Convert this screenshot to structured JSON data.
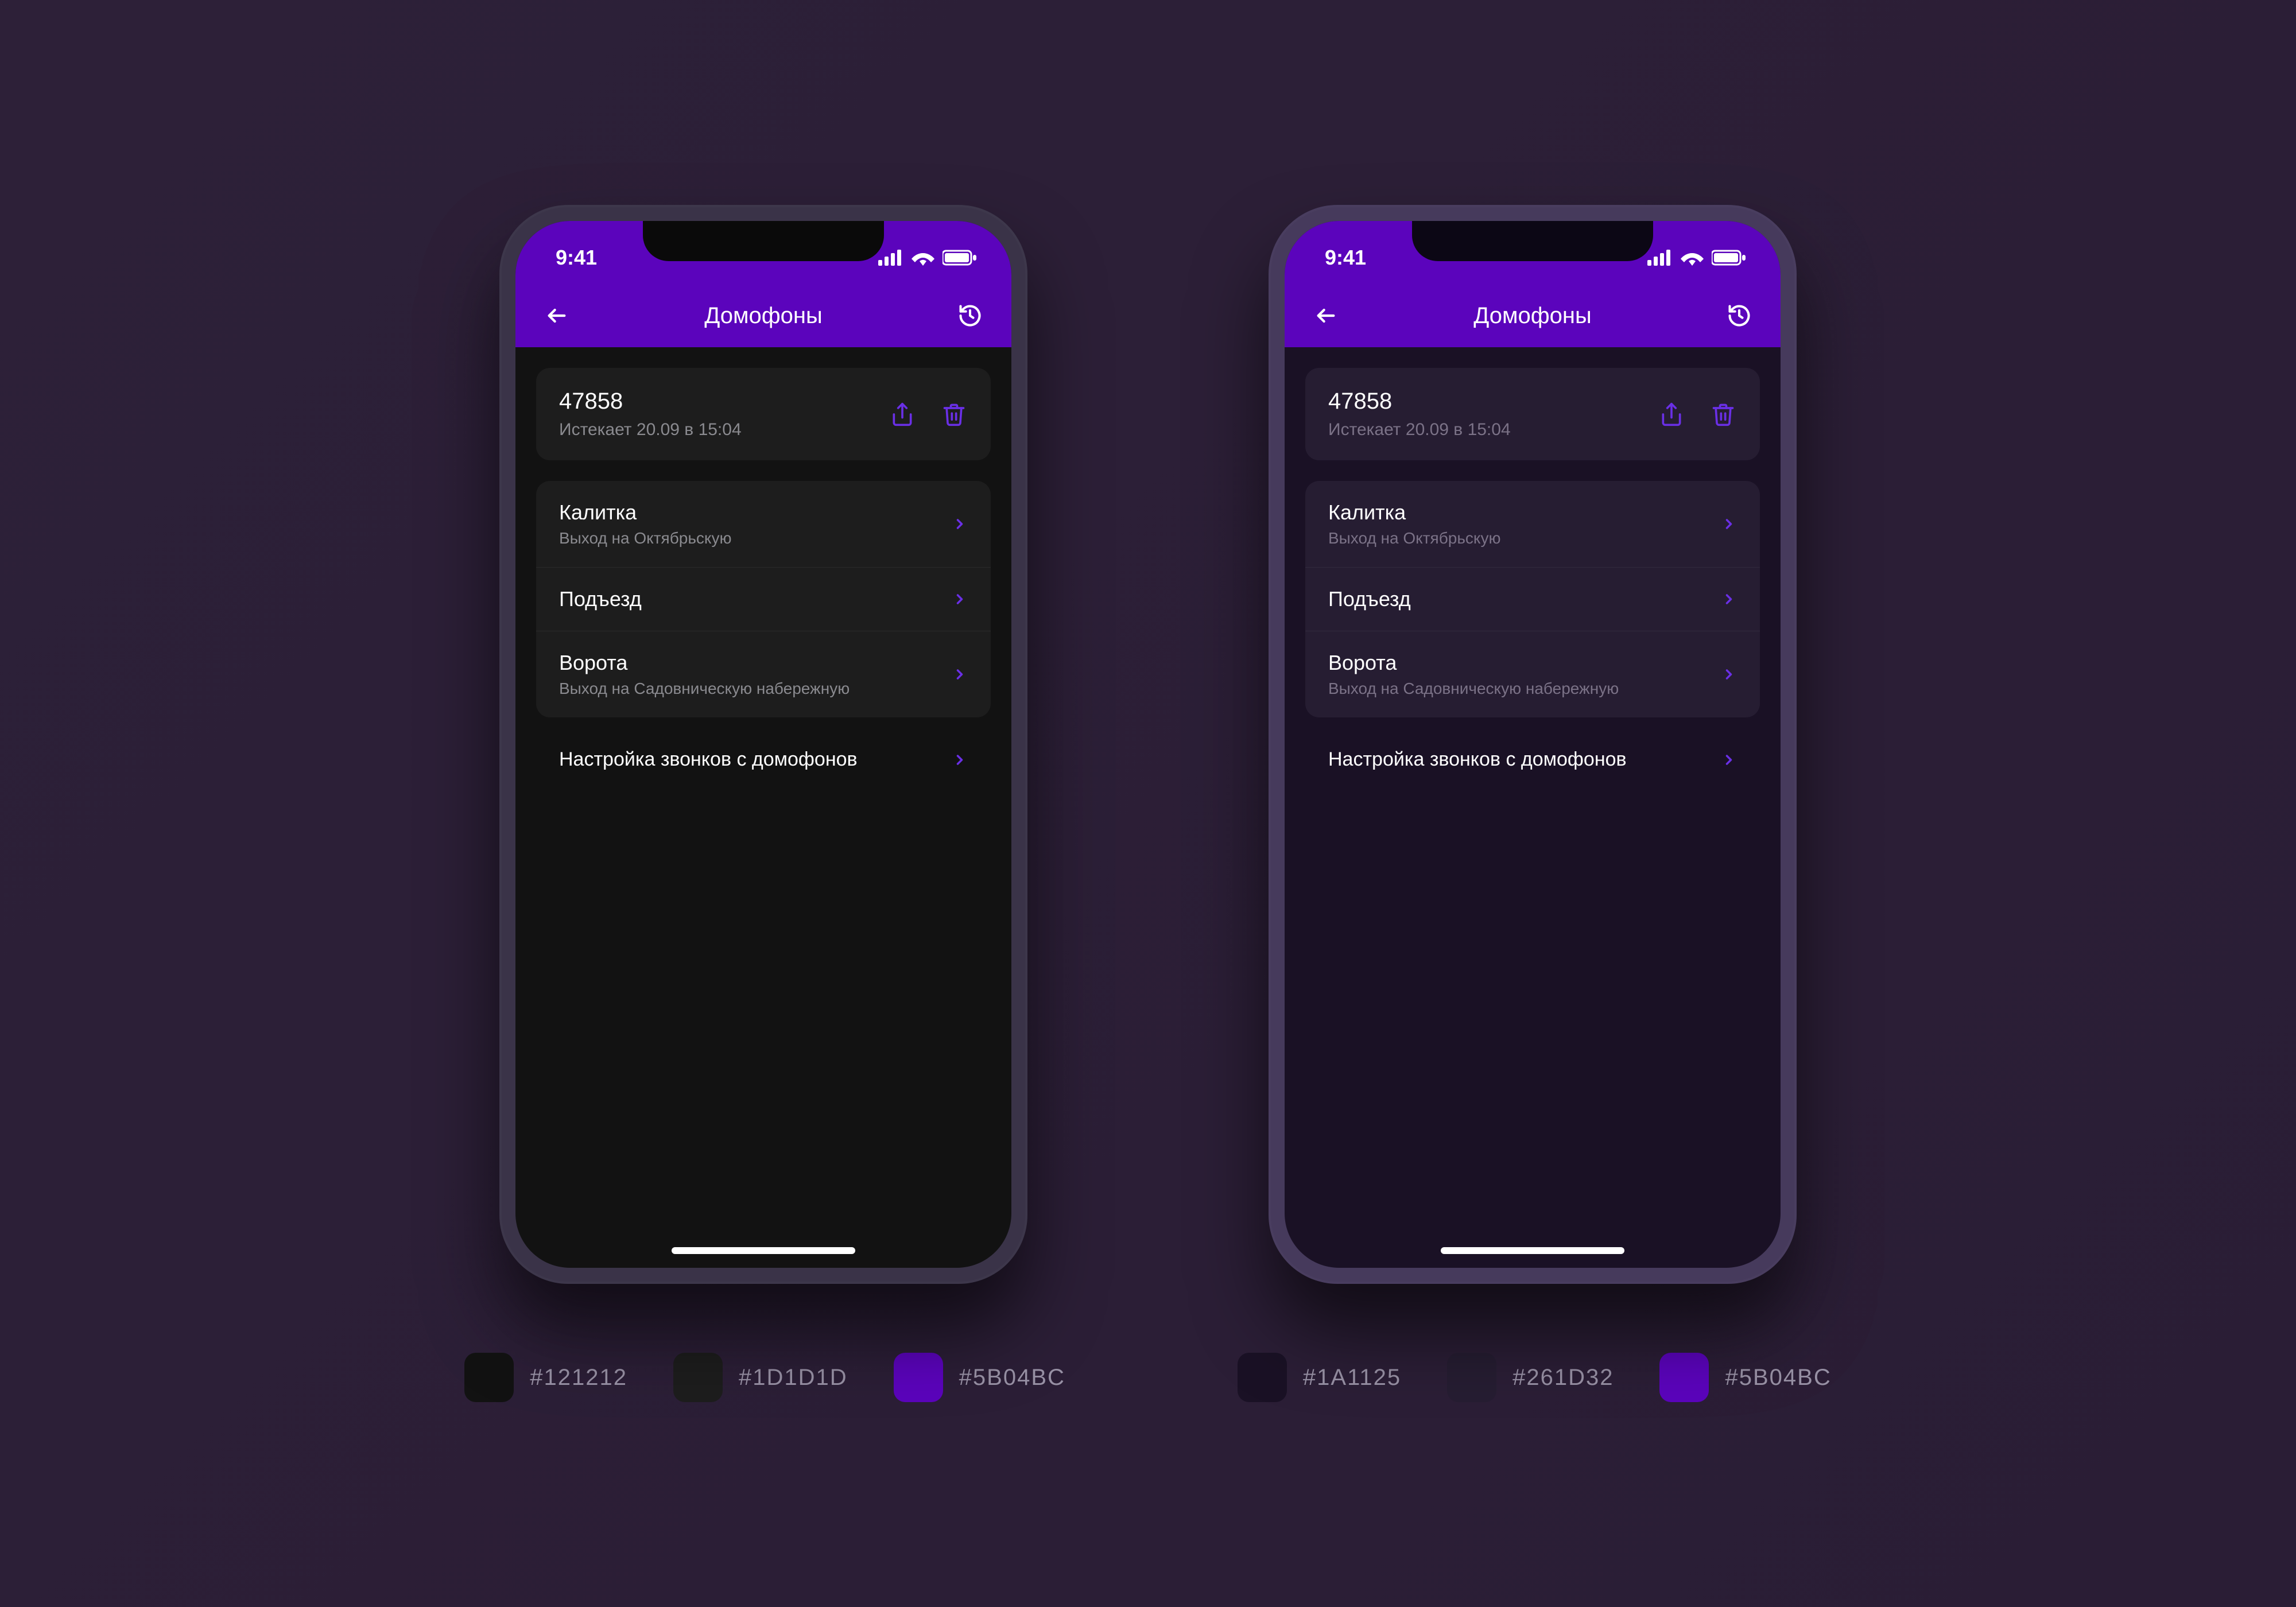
{
  "status": {
    "time": "9:41"
  },
  "navbar": {
    "title": "Домофоны"
  },
  "code": {
    "value": "47858",
    "expires": "Истекает 20.09 в 15:04"
  },
  "entries": [
    {
      "title": "Калитка",
      "sub": "Выход на Октябрьскую"
    },
    {
      "title": "Подъезд",
      "sub": ""
    },
    {
      "title": "Ворота",
      "sub": "Выход на Садовническую набережную"
    }
  ],
  "settings": {
    "label": "Настройка звонков с домофонов"
  },
  "palette": {
    "left": [
      {
        "hex": "#121212"
      },
      {
        "hex": "#1D1D1D"
      },
      {
        "hex": "#5B04BC"
      }
    ],
    "right": [
      {
        "hex": "#1A1125"
      },
      {
        "hex": "#261D32"
      },
      {
        "hex": "#5B04BC"
      }
    ]
  }
}
